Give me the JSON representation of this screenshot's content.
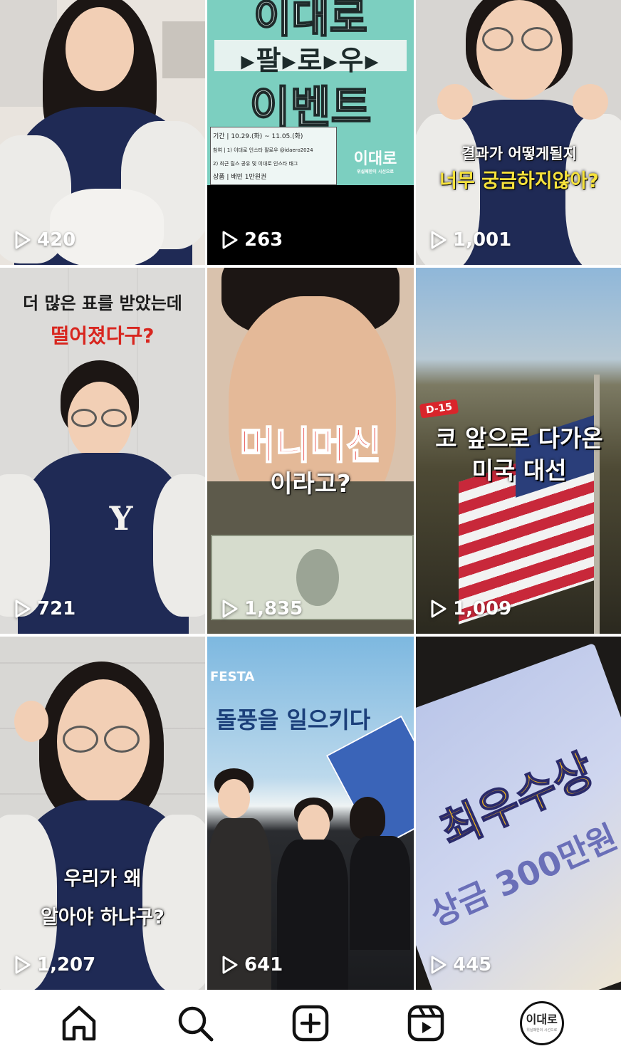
{
  "posts": [
    {
      "views": "420"
    },
    {
      "views": "263",
      "poster": {
        "line1": "이대로",
        "line2": "▸팔▸로▸우▸",
        "line3": "이벤트",
        "info1": "기간 | 10.29.(화) ~ 11.05.(화)",
        "info2": "참여 | 1) 이대로 인스타 팔로우 @idaero2024",
        "info3": "2) 최근 릴스 공유 및 이대로 인스타 태그",
        "info4": "상품 | 배민 1만원권",
        "brand": "이대로",
        "brand_sub": "위실패한이 시선으로"
      }
    },
    {
      "views": "1,001",
      "caption1": "결과가 어떻게될지",
      "caption2": "너무 궁금하지않아?"
    },
    {
      "views": "721",
      "caption1": "더 많은 표를 받았는데",
      "caption2": "떨어졌다구?"
    },
    {
      "views": "1,835",
      "caption1": "머니머신",
      "caption2": "이라고?"
    },
    {
      "views": "1,009",
      "badge": "D-15",
      "caption1": "코 앞으로 다가온",
      "caption2": "미국 대선"
    },
    {
      "views": "1,207",
      "caption1": "우리가 왜",
      "caption2": "알아야 하냐구?"
    },
    {
      "views": "641",
      "caption1": "돌풍을 일으키다",
      "festa": "FESTA"
    },
    {
      "views": "445",
      "caption1": "최우수상",
      "caption2": "상금 300만원"
    }
  ],
  "nav": {
    "items": [
      "home-icon",
      "search-icon",
      "create-icon",
      "reels-icon",
      "profile"
    ],
    "profile_text": "이대로",
    "profile_sub": "위실패한의 시선으로"
  }
}
